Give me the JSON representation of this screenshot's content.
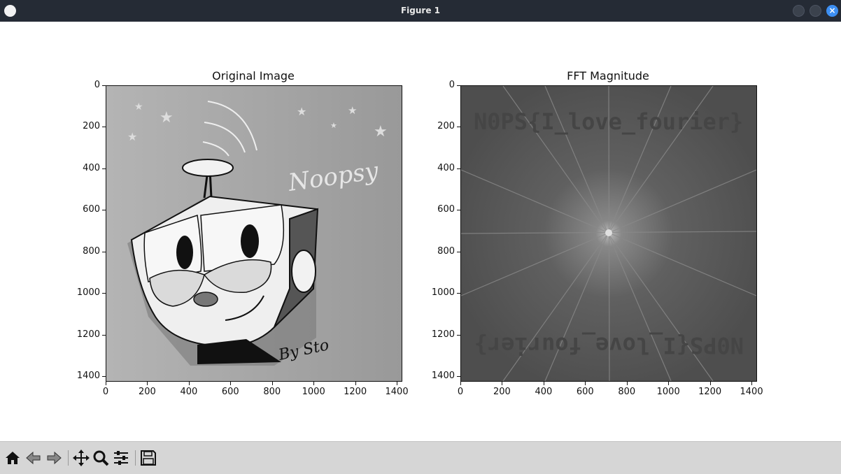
{
  "window": {
    "title": "Figure 1"
  },
  "plots": [
    {
      "title": "Original Image",
      "image": "grayscale cartoon character drawing signed \"By Sto\"",
      "overlay_text": [
        "Noopsy",
        "By Sto"
      ]
    },
    {
      "title": "FFT Magnitude",
      "image": "gray FFT magnitude spectrum with bright center star pattern",
      "overlay_text": [
        "N0PS{I_love_fourier}"
      ]
    }
  ],
  "axis": {
    "yticks": [
      "0",
      "200",
      "400",
      "600",
      "800",
      "1000",
      "1200",
      "1400"
    ],
    "xticks": [
      "0",
      "200",
      "400",
      "600",
      "800",
      "1000",
      "1200",
      "1400"
    ]
  },
  "toolbar": {
    "buttons": [
      "home-icon",
      "back-icon",
      "forward-icon",
      "pan-icon",
      "zoom-icon",
      "configure-subplots-icon",
      "save-icon"
    ]
  },
  "colors": {
    "titlebar": "#252b35",
    "toolbar": "#d6d6d6",
    "close": "#3d8ff2"
  }
}
